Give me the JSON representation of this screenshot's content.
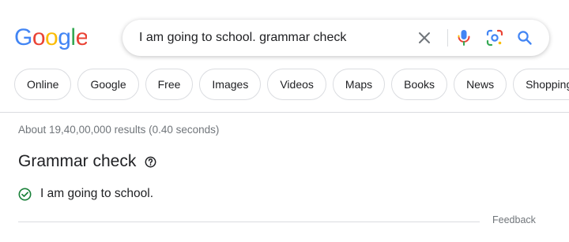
{
  "logo": {
    "text": "Google",
    "letters": [
      {
        "char": "G",
        "color": "#4285F4"
      },
      {
        "char": "o",
        "color": "#EA4335"
      },
      {
        "char": "o",
        "color": "#FBBC05"
      },
      {
        "char": "g",
        "color": "#4285F4"
      },
      {
        "char": "l",
        "color": "#34A853"
      },
      {
        "char": "e",
        "color": "#EA4335"
      }
    ]
  },
  "search": {
    "query": "I am going to school. grammar check",
    "icons": [
      "close-icon",
      "microphone-icon",
      "lens-icon",
      "search-icon"
    ]
  },
  "filters": [
    {
      "label": "Online"
    },
    {
      "label": "Google"
    },
    {
      "label": "Free"
    },
    {
      "label": "Images"
    },
    {
      "label": "Videos"
    },
    {
      "label": "Maps"
    },
    {
      "label": "Books"
    },
    {
      "label": "News"
    },
    {
      "label": "Shopping"
    }
  ],
  "results": {
    "stats": "About 19,40,00,000 results (0.40 seconds)"
  },
  "grammar_check": {
    "title": "Grammar check",
    "result": "I am going to school.",
    "status_color": "#188038"
  },
  "feedback": {
    "label": "Feedback"
  }
}
